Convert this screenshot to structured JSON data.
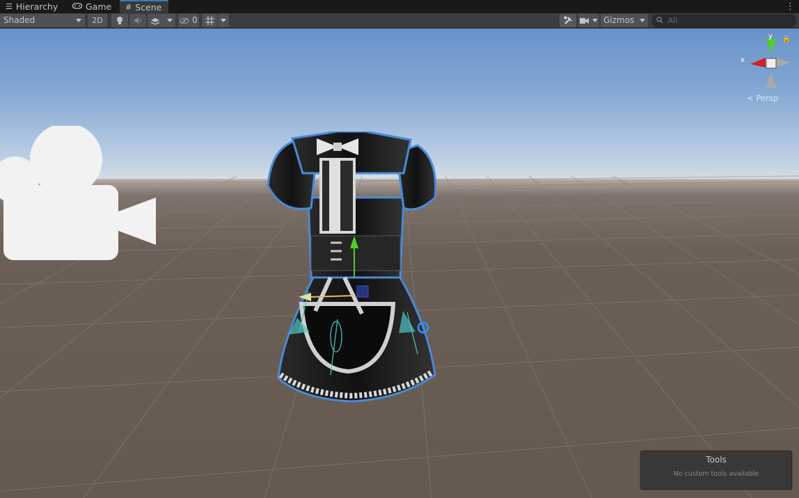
{
  "tabs": [
    {
      "label": "Hierarchy",
      "icon": "list-icon"
    },
    {
      "label": "Game",
      "icon": "gamepad-icon"
    },
    {
      "label": "Scene",
      "icon": "grid-icon",
      "active": true
    }
  ],
  "tab_menu_icon": "kebab-menu-icon",
  "toolbar": {
    "draw_mode": "Shaded",
    "toggle_2d": "2D",
    "scene_visibility_count": "0",
    "gizmos_label": "Gizmos",
    "search_placeholder": "All"
  },
  "gizmo": {
    "x_label": "x",
    "y_label": "y",
    "projection": "Persp"
  },
  "tools_overlay": {
    "title": "Tools",
    "subtitle": "No custom tools available"
  },
  "colors": {
    "accent": "#3a79bb",
    "toolbar_bg": "#3c3c3c",
    "axis_x": "#d02020",
    "axis_y": "#4fcc29",
    "selection_outline": "#4a8ad8"
  }
}
